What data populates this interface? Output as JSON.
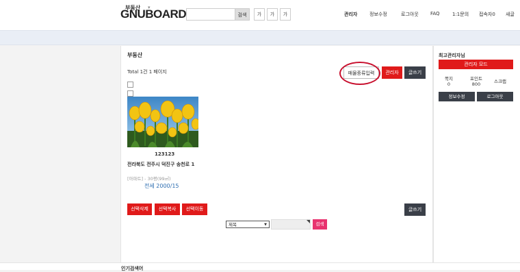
{
  "header": {
    "logo": "GNUBOARD5",
    "search_button": "검색",
    "font_buttons": [
      "가",
      "가",
      "가"
    ],
    "nav": [
      "관리자",
      "정보수정",
      "로그아웃",
      "FAQ",
      "1:1문의",
      "접속자0",
      "새글"
    ]
  },
  "gnb": {
    "menu_label": "부동산"
  },
  "board": {
    "title": "부동산",
    "total": "Total 1건 1 페이지",
    "buttons": {
      "property_type_input": "매물종류입력",
      "admin": "관리자",
      "write": "글쓰기",
      "delete_selected": "선택삭제",
      "copy_selected": "선택복사",
      "move_selected": "선택이동",
      "write_bottom": "글쓰기"
    },
    "item": {
      "title": "123123",
      "address": "전라북도 전주시 덕진구 송천로 1",
      "type": "[아파트] - 30평(99㎡)",
      "price": "전세 2000/15"
    },
    "search": {
      "select_value": "제목",
      "button": "검색"
    }
  },
  "aside": {
    "title": "최고관리자님",
    "admin_mode": "관리자 모드",
    "stats": [
      {
        "label": "쪽지",
        "value": "0"
      },
      {
        "label": "포인트",
        "value": "800"
      }
    ],
    "scrap": "스크랩",
    "edit_profile": "정보수정",
    "logout": "로그아웃"
  },
  "footer": {
    "text": "인기검색어"
  },
  "colors": {
    "accent_red": "#e01a1a",
    "dark_button": "#3a3f48",
    "search_pink": "#e8336f",
    "price_blue": "#2b6cb0",
    "highlight_circle": "#c8102e"
  }
}
